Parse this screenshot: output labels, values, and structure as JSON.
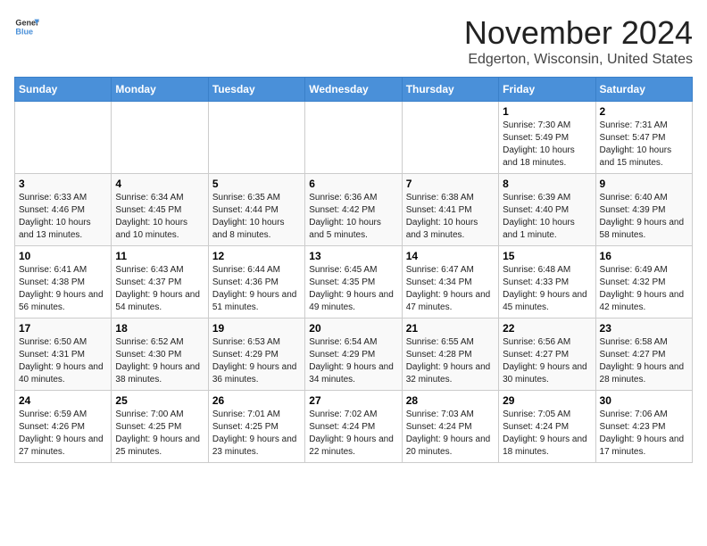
{
  "header": {
    "logo_general": "General",
    "logo_blue": "Blue",
    "title": "November 2024",
    "subtitle": "Edgerton, Wisconsin, United States"
  },
  "calendar": {
    "days_of_week": [
      "Sunday",
      "Monday",
      "Tuesday",
      "Wednesday",
      "Thursday",
      "Friday",
      "Saturday"
    ],
    "weeks": [
      [
        {
          "day": "",
          "info": ""
        },
        {
          "day": "",
          "info": ""
        },
        {
          "day": "",
          "info": ""
        },
        {
          "day": "",
          "info": ""
        },
        {
          "day": "",
          "info": ""
        },
        {
          "day": "1",
          "info": "Sunrise: 7:30 AM\nSunset: 5:49 PM\nDaylight: 10 hours and 18 minutes."
        },
        {
          "day": "2",
          "info": "Sunrise: 7:31 AM\nSunset: 5:47 PM\nDaylight: 10 hours and 15 minutes."
        }
      ],
      [
        {
          "day": "3",
          "info": "Sunrise: 6:33 AM\nSunset: 4:46 PM\nDaylight: 10 hours and 13 minutes."
        },
        {
          "day": "4",
          "info": "Sunrise: 6:34 AM\nSunset: 4:45 PM\nDaylight: 10 hours and 10 minutes."
        },
        {
          "day": "5",
          "info": "Sunrise: 6:35 AM\nSunset: 4:44 PM\nDaylight: 10 hours and 8 minutes."
        },
        {
          "day": "6",
          "info": "Sunrise: 6:36 AM\nSunset: 4:42 PM\nDaylight: 10 hours and 5 minutes."
        },
        {
          "day": "7",
          "info": "Sunrise: 6:38 AM\nSunset: 4:41 PM\nDaylight: 10 hours and 3 minutes."
        },
        {
          "day": "8",
          "info": "Sunrise: 6:39 AM\nSunset: 4:40 PM\nDaylight: 10 hours and 1 minute."
        },
        {
          "day": "9",
          "info": "Sunrise: 6:40 AM\nSunset: 4:39 PM\nDaylight: 9 hours and 58 minutes."
        }
      ],
      [
        {
          "day": "10",
          "info": "Sunrise: 6:41 AM\nSunset: 4:38 PM\nDaylight: 9 hours and 56 minutes."
        },
        {
          "day": "11",
          "info": "Sunrise: 6:43 AM\nSunset: 4:37 PM\nDaylight: 9 hours and 54 minutes."
        },
        {
          "day": "12",
          "info": "Sunrise: 6:44 AM\nSunset: 4:36 PM\nDaylight: 9 hours and 51 minutes."
        },
        {
          "day": "13",
          "info": "Sunrise: 6:45 AM\nSunset: 4:35 PM\nDaylight: 9 hours and 49 minutes."
        },
        {
          "day": "14",
          "info": "Sunrise: 6:47 AM\nSunset: 4:34 PM\nDaylight: 9 hours and 47 minutes."
        },
        {
          "day": "15",
          "info": "Sunrise: 6:48 AM\nSunset: 4:33 PM\nDaylight: 9 hours and 45 minutes."
        },
        {
          "day": "16",
          "info": "Sunrise: 6:49 AM\nSunset: 4:32 PM\nDaylight: 9 hours and 42 minutes."
        }
      ],
      [
        {
          "day": "17",
          "info": "Sunrise: 6:50 AM\nSunset: 4:31 PM\nDaylight: 9 hours and 40 minutes."
        },
        {
          "day": "18",
          "info": "Sunrise: 6:52 AM\nSunset: 4:30 PM\nDaylight: 9 hours and 38 minutes."
        },
        {
          "day": "19",
          "info": "Sunrise: 6:53 AM\nSunset: 4:29 PM\nDaylight: 9 hours and 36 minutes."
        },
        {
          "day": "20",
          "info": "Sunrise: 6:54 AM\nSunset: 4:29 PM\nDaylight: 9 hours and 34 minutes."
        },
        {
          "day": "21",
          "info": "Sunrise: 6:55 AM\nSunset: 4:28 PM\nDaylight: 9 hours and 32 minutes."
        },
        {
          "day": "22",
          "info": "Sunrise: 6:56 AM\nSunset: 4:27 PM\nDaylight: 9 hours and 30 minutes."
        },
        {
          "day": "23",
          "info": "Sunrise: 6:58 AM\nSunset: 4:27 PM\nDaylight: 9 hours and 28 minutes."
        }
      ],
      [
        {
          "day": "24",
          "info": "Sunrise: 6:59 AM\nSunset: 4:26 PM\nDaylight: 9 hours and 27 minutes."
        },
        {
          "day": "25",
          "info": "Sunrise: 7:00 AM\nSunset: 4:25 PM\nDaylight: 9 hours and 25 minutes."
        },
        {
          "day": "26",
          "info": "Sunrise: 7:01 AM\nSunset: 4:25 PM\nDaylight: 9 hours and 23 minutes."
        },
        {
          "day": "27",
          "info": "Sunrise: 7:02 AM\nSunset: 4:24 PM\nDaylight: 9 hours and 22 minutes."
        },
        {
          "day": "28",
          "info": "Sunrise: 7:03 AM\nSunset: 4:24 PM\nDaylight: 9 hours and 20 minutes."
        },
        {
          "day": "29",
          "info": "Sunrise: 7:05 AM\nSunset: 4:24 PM\nDaylight: 9 hours and 18 minutes."
        },
        {
          "day": "30",
          "info": "Sunrise: 7:06 AM\nSunset: 4:23 PM\nDaylight: 9 hours and 17 minutes."
        }
      ]
    ]
  }
}
